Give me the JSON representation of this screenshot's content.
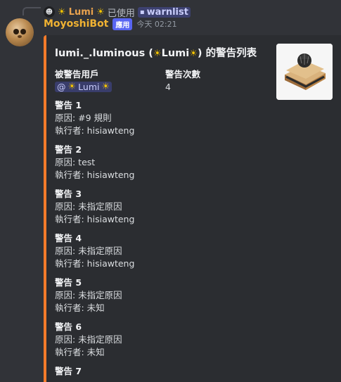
{
  "reply": {
    "avatar_icon": "bot-face-icon",
    "user_display": "Lumi",
    "used_text": "已使用",
    "command": "warnlist"
  },
  "message": {
    "author": "MoyoshiBot",
    "badge": "應用",
    "timestamp": "今天 02:21"
  },
  "embed": {
    "accent_color": "#f47b2a",
    "title_prefix": "lumi._.luminous (",
    "title_name": "Lumi",
    "title_suffix": ") 的警告列表",
    "thumbnail_icon": "sandwich-icon",
    "fields": [
      {
        "name": "被警告用戶",
        "mention_prefix": "@",
        "mention_name": "Lumi"
      },
      {
        "name": "警告次數",
        "value": "4"
      }
    ],
    "warnings": [
      {
        "title": "警告 1",
        "reason": "原因: #9 規則",
        "executor": "執行者: hisiawteng"
      },
      {
        "title": "警告 2",
        "reason": "原因: test",
        "executor": "執行者: hisiawteng"
      },
      {
        "title": "警告 3",
        "reason": "原因: 未指定原因",
        "executor": "執行者: hisiawteng"
      },
      {
        "title": "警告 4",
        "reason": "原因: 未指定原因",
        "executor": "執行者: hisiawteng"
      },
      {
        "title": "警告 5",
        "reason": "原因: 未指定原因",
        "executor": "執行者: 未知"
      },
      {
        "title": "警告 6",
        "reason": "原因: 未指定原因",
        "executor": "執行者: 未知"
      },
      {
        "title": "警告 7"
      }
    ]
  }
}
